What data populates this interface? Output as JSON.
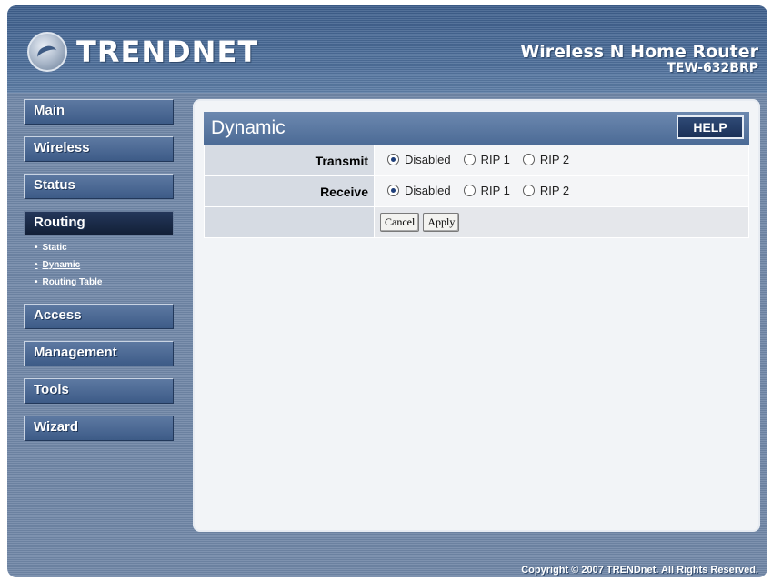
{
  "header": {
    "logo_text": "TRENDNET",
    "product_name": "Wireless N Home Router",
    "product_model": "TEW-632BRP"
  },
  "sidebar": {
    "items": [
      {
        "label": "Main"
      },
      {
        "label": "Wireless"
      },
      {
        "label": "Status"
      },
      {
        "label": "Routing"
      },
      {
        "label": "Access"
      },
      {
        "label": "Management"
      },
      {
        "label": "Tools"
      },
      {
        "label": "Wizard"
      }
    ],
    "active": "Routing",
    "routing_sub": [
      {
        "label": "Static"
      },
      {
        "label": "Dynamic"
      },
      {
        "label": "Routing Table"
      }
    ],
    "current_sub": "Dynamic"
  },
  "main": {
    "title": "Dynamic",
    "help_label": "HELP",
    "rows": [
      {
        "label": "Transmit",
        "selected": "Disabled"
      },
      {
        "label": "Receive",
        "selected": "Disabled"
      }
    ],
    "options": [
      "Disabled",
      "RIP 1",
      "RIP 2"
    ],
    "buttons": {
      "cancel": "Cancel",
      "apply": "Apply"
    }
  },
  "footer": {
    "copyright": "Copyright © 2007 TRENDnet. All Rights Reserved."
  },
  "colors": {
    "frame_bg": "#6f86a6",
    "nav_button": "#4b6893",
    "nav_active": "#1b2b47",
    "titlebar": "#5a779f",
    "help_button": "#233b64"
  }
}
